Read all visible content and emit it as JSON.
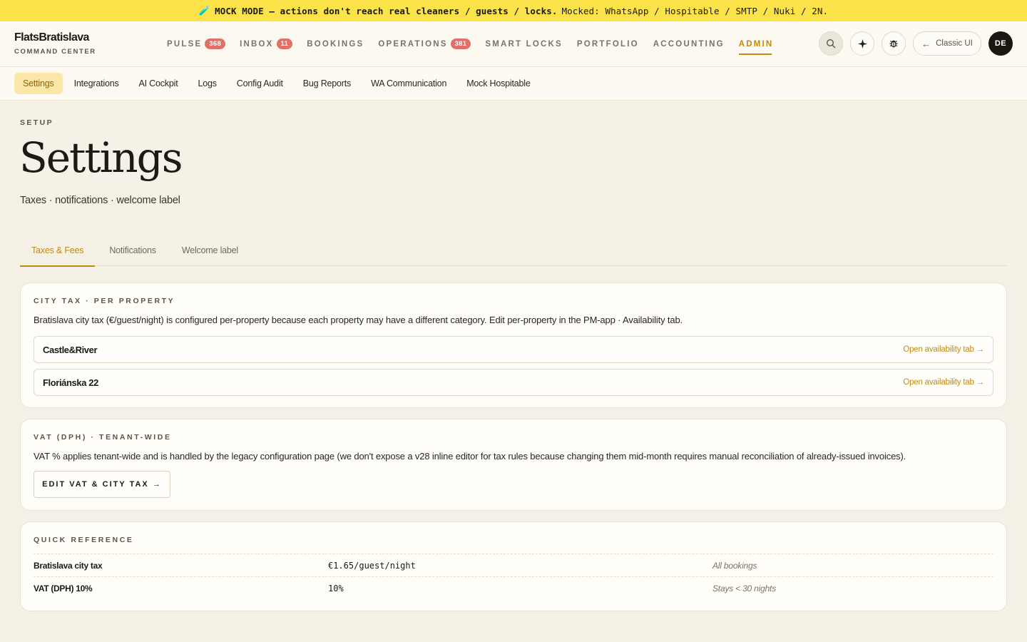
{
  "banner": {
    "icon": "test-tube-icon",
    "bold_text": "MOCK MODE — actions don't reach real cleaners / guests / locks.",
    "rest_text": "Mocked: WhatsApp / Hospitable / SMTP / Nuki / 2N."
  },
  "brand": {
    "name": "FlatsBratislava",
    "subtitle": "COMMAND CENTER"
  },
  "nav": {
    "items": [
      {
        "label": "PULSE",
        "count": "368"
      },
      {
        "label": "INBOX",
        "count": "11"
      },
      {
        "label": "BOOKINGS"
      },
      {
        "label": "OPERATIONS",
        "count": "381"
      },
      {
        "label": "SMART LOCKS"
      },
      {
        "label": "PORTFOLIO"
      },
      {
        "label": "ACCOUNTING"
      },
      {
        "label": "ADMIN"
      }
    ],
    "active": "ADMIN",
    "accent_color": "#c08a11",
    "badge_color": "#e1706a"
  },
  "header_actions": {
    "classic_label": "Classic UI",
    "avatar_initials": "DE",
    "icons": [
      "search-icon",
      "sparkle-icon",
      "bug-icon",
      "arrow-left-icon"
    ]
  },
  "subnav": {
    "items": [
      "Settings",
      "Integrations",
      "AI Cockpit",
      "Logs",
      "Config Audit",
      "Bug Reports",
      "WA Communication",
      "Mock Hospitable"
    ],
    "active": "Settings"
  },
  "page": {
    "eyebrow": "SETUP",
    "title": "Settings",
    "subtitle": "Taxes · notifications · welcome label"
  },
  "tabs": {
    "items": [
      "Taxes & Fees",
      "Notifications",
      "Welcome label"
    ],
    "active": "Taxes & Fees"
  },
  "city_tax": {
    "label": "CITY TAX · PER PROPERTY",
    "description": "Bratislava city tax (€/guest/night) is configured per-property because each property may have a different category. Edit per-property in the PM-app · Availability tab.",
    "properties": [
      {
        "name": "Castle&River",
        "link": "Open availability tab →"
      },
      {
        "name": "Floriánska 22",
        "link": "Open availability tab →"
      }
    ]
  },
  "vat": {
    "label": "VAT (DPH) · TENANT-WIDE",
    "description": "VAT % applies tenant-wide and is handled by the legacy configuration page (we don't expose a v28 inline editor for tax rules because changing them mid-month requires manual reconciliation of already-issued invoices).",
    "button_label": "EDIT VAT & CITY TAX →"
  },
  "quick_reference": {
    "label": "QUICK REFERENCE",
    "rows": [
      {
        "name": "Bratislava city tax",
        "value": "€1.65/guest/night",
        "scope": "All bookings"
      },
      {
        "name": "VAT (DPH) 10%",
        "value": "10%",
        "scope": "Stays < 30 nights"
      }
    ]
  }
}
